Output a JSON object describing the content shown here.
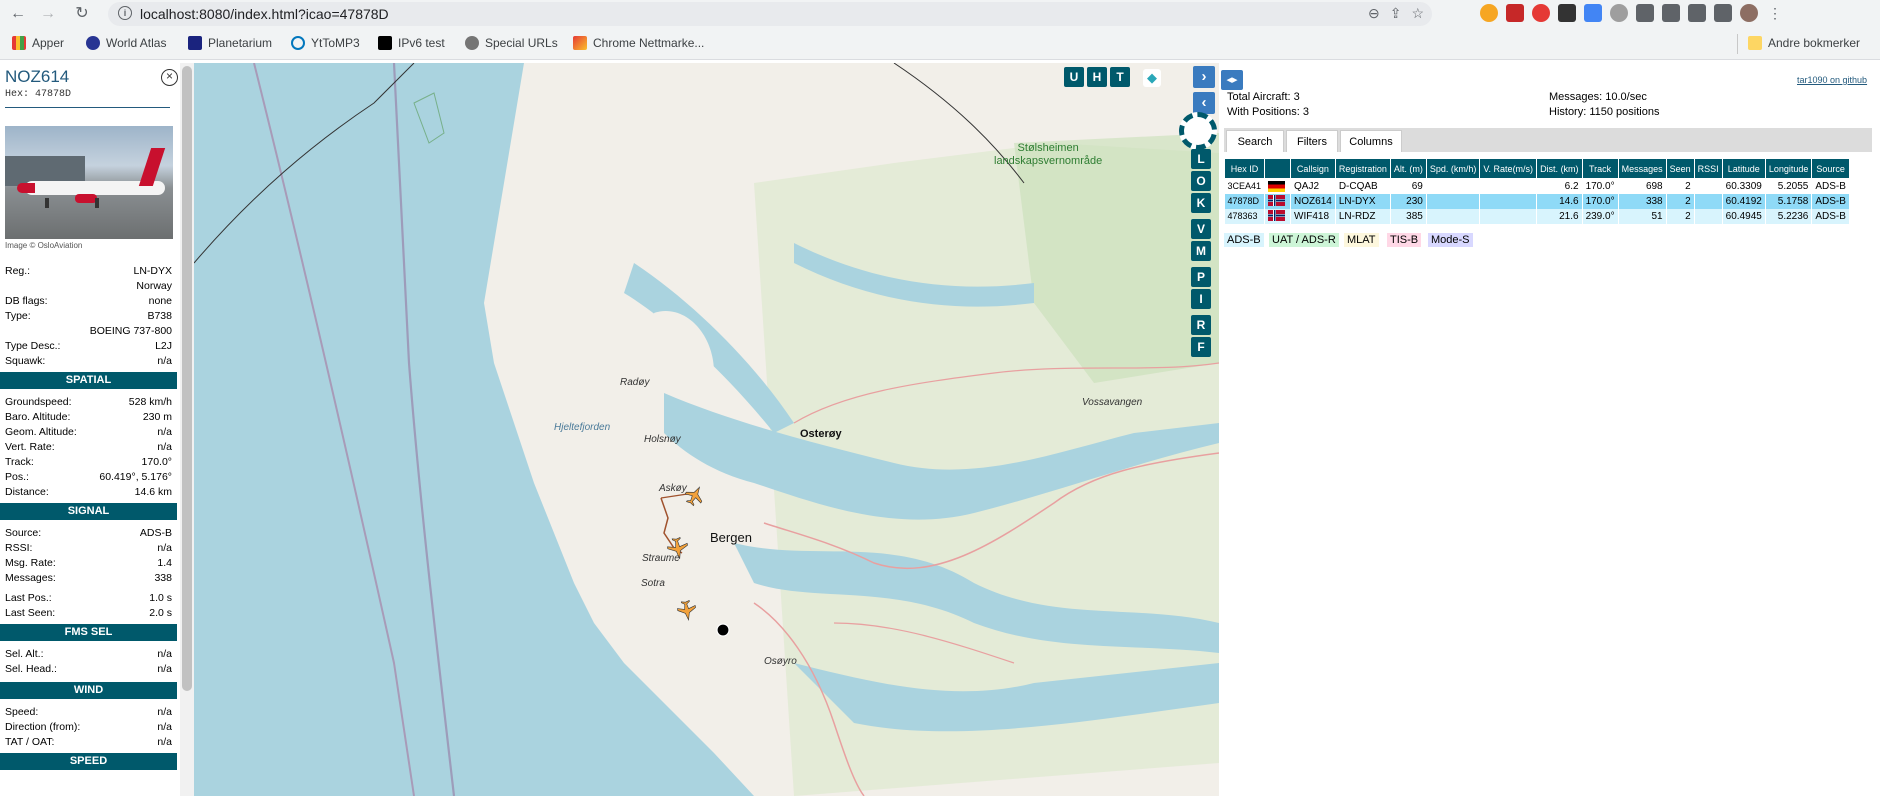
{
  "browser": {
    "url": "localhost:8080/index.html?icao=47878D",
    "bookmarks": [
      "Apper",
      "World Atlas",
      "Planetarium",
      "YtToMP3",
      "IPv6 test",
      "Special URLs",
      "Chrome Nettmarke..."
    ],
    "other_bookmarks": "Andre bokmerker"
  },
  "sidebar": {
    "callsign": "NOZ614",
    "hex_label": "Hex:",
    "hex": "47878D",
    "photo_credit": "Image © OsloAviation",
    "info": [
      {
        "k": "Reg.:",
        "v": "LN-DYX"
      },
      {
        "k": "",
        "v": "Norway"
      },
      {
        "k": "DB flags:",
        "v": "none"
      },
      {
        "k": "Type:",
        "v": "B738"
      },
      {
        "k": "",
        "v": "BOEING 737-800"
      },
      {
        "k": "Type Desc.:",
        "v": "L2J"
      },
      {
        "k": "Squawk:",
        "v": "n/a"
      }
    ],
    "spatial_title": "SPATIAL",
    "spatial": [
      {
        "k": "Groundspeed:",
        "v": "528 km/h"
      },
      {
        "k": "Baro. Altitude:",
        "v": "230 m"
      },
      {
        "k": "Geom. Altitude:",
        "v": "n/a"
      },
      {
        "k": "Vert. Rate:",
        "v": "n/a"
      },
      {
        "k": "Track:",
        "v": "170.0°"
      },
      {
        "k": "Pos.:",
        "v": "60.419°, 5.176°"
      },
      {
        "k": "Distance:",
        "v": "14.6 km"
      }
    ],
    "signal_title": "SIGNAL",
    "signal": [
      {
        "k": "Source:",
        "v": "ADS-B"
      },
      {
        "k": "RSSI:",
        "v": "n/a"
      },
      {
        "k": "Msg. Rate:",
        "v": "1.4"
      },
      {
        "k": "Messages:",
        "v": "338"
      },
      {
        "k": "Last Pos.:",
        "v": "1.0 s"
      },
      {
        "k": "Last Seen:",
        "v": "2.0 s"
      }
    ],
    "fms_title": "FMS SEL",
    "fms": [
      {
        "k": "Sel. Alt.:",
        "v": "n/a"
      },
      {
        "k": "Sel. Head.:",
        "v": "n/a"
      }
    ],
    "wind_title": "WIND",
    "wind": [
      {
        "k": "Speed:",
        "v": "n/a"
      },
      {
        "k": "Direction (from):",
        "v": "n/a"
      },
      {
        "k": "TAT / OAT:",
        "v": "n/a"
      }
    ],
    "speed_title": "SPEED"
  },
  "map": {
    "buttons_top": [
      "U",
      "H",
      "T"
    ],
    "buttons_side": [
      "L",
      "O",
      "K",
      "V",
      "M",
      "P",
      "I",
      "R",
      "F"
    ],
    "labels": {
      "park": "Stølsheimen\nlandskapsvernområde",
      "vossavangen": "Vossavangen",
      "osteroy": "Osterøy",
      "radoy": "Radøy",
      "hjeltefjorden": "Hjeltefjorden",
      "holsnoy": "Holsnøy",
      "askoy": "Askøy",
      "bergen": "Bergen",
      "straume": "Straume",
      "sotra": "Sotra",
      "osoyro": "Osøyro"
    }
  },
  "panel": {
    "total_aircraft_label": "Total Aircraft:",
    "total_aircraft": "3",
    "with_positions_label": "With Positions:",
    "with_positions": "3",
    "messages_label": "Messages:",
    "messages": "10.0/sec",
    "history_label": "History:",
    "history": "1150 positions",
    "github": "tar1090 on github",
    "tabs": [
      "Search",
      "Filters",
      "Columns"
    ],
    "columns": [
      "Hex ID",
      "",
      "Callsign",
      "Registration",
      "Alt. (m)",
      "Spd. (km/h)",
      "V. Rate(m/s)",
      "Dist. (km)",
      "Track",
      "Messages",
      "Seen",
      "RSSI",
      "Latitude",
      "Longitude",
      "Source"
    ],
    "rows": [
      {
        "hex": "3CEA41",
        "flag": "germany",
        "callsign": "QAJ2",
        "reg": "D-CQAB",
        "alt": "69",
        "spd": "",
        "vrate": "",
        "dist": "6.2",
        "track": "170.0°",
        "msgs": "698",
        "seen": "2",
        "rssi": "",
        "lat": "60.3309",
        "lon": "5.2055",
        "src": "ADS-B"
      },
      {
        "hex": "47878D",
        "flag": "norway",
        "callsign": "NOZ614",
        "reg": "LN-DYX",
        "alt": "230",
        "spd": "",
        "vrate": "",
        "dist": "14.6",
        "track": "170.0°",
        "msgs": "338",
        "seen": "2",
        "rssi": "",
        "lat": "60.4192",
        "lon": "5.1758",
        "src": "ADS-B"
      },
      {
        "hex": "478363",
        "flag": "norway",
        "callsign": "WIF418",
        "reg": "LN-RDZ",
        "alt": "385",
        "spd": "",
        "vrate": "",
        "dist": "21.6",
        "track": "239.0°",
        "msgs": "51",
        "seen": "2",
        "rssi": "",
        "lat": "60.4945",
        "lon": "5.2236",
        "src": "ADS-B"
      }
    ],
    "legend": [
      {
        "label": "ADS-B",
        "color": "#d8f4fd"
      },
      {
        "label": "UAT / ADS-R",
        "color": "#cdf5d7"
      },
      {
        "label": "MLAT",
        "color": "#fdf7dd"
      },
      {
        "label": "TIS-B",
        "color": "#ffd8e6"
      },
      {
        "label": "Mode-S",
        "color": "#d8d8ff"
      }
    ]
  },
  "colors": {
    "accent": "#00596b",
    "selected_row": "#8fdaf7",
    "title": "#235a7d"
  }
}
